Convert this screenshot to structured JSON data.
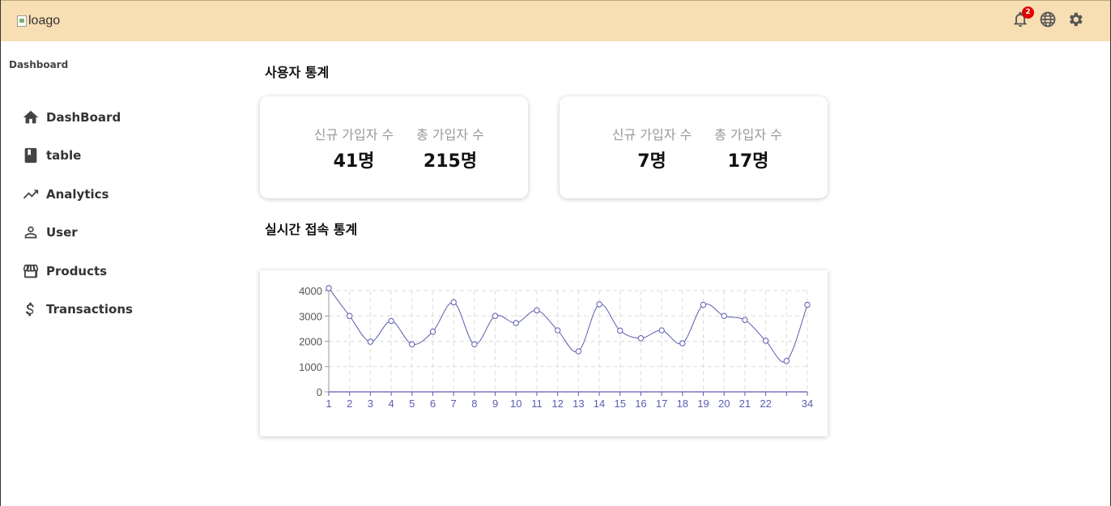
{
  "header": {
    "logo_alt": "loago",
    "notification_count": "2",
    "icons": [
      "bell-icon",
      "globe-icon",
      "gear-icon"
    ],
    "background": "#f7deb3"
  },
  "sidebar": {
    "title": "Dashboard",
    "items": [
      {
        "label": "DashBoard",
        "icon": "home-icon"
      },
      {
        "label": "table",
        "icon": "book-icon"
      },
      {
        "label": "Analytics",
        "icon": "trending-up-icon"
      },
      {
        "label": "User",
        "icon": "user-icon"
      },
      {
        "label": "Products",
        "icon": "store-icon"
      },
      {
        "label": "Transactions",
        "icon": "dollar-icon"
      }
    ]
  },
  "main": {
    "user_stats_title": "사용자 통계",
    "cards": [
      {
        "new_label": "신규 가입자 수",
        "new_value": "41명",
        "total_label": "총 가입자 수",
        "total_value": "215명"
      },
      {
        "new_label": "신규 가입자 수",
        "new_value": "7명",
        "total_label": "총 가입자 수",
        "total_value": "17명"
      }
    ],
    "realtime_title": "실시간 접속 통계"
  },
  "chart_data": {
    "type": "line",
    "x": [
      "1",
      "2",
      "3",
      "4",
      "5",
      "6",
      "7",
      "8",
      "9",
      "10",
      "11",
      "12",
      "13",
      "14",
      "15",
      "16",
      "17",
      "18",
      "19",
      "20",
      "21",
      "22",
      "23",
      "34"
    ],
    "tick_labels": [
      "1",
      "2",
      "3",
      "4",
      "5",
      "6",
      "7",
      "8",
      "9",
      "10",
      "11",
      "12",
      "13",
      "14",
      "15",
      "16",
      "17",
      "18",
      "19",
      "20",
      "21",
      "22",
      "",
      "34"
    ],
    "series": [
      {
        "values": [
          4100,
          3000,
          1980,
          2800,
          1880,
          2380,
          3540,
          1880,
          3000,
          2720,
          3220,
          2430,
          1600,
          3460,
          2420,
          2120,
          2430,
          1920,
          3440,
          3000,
          2840,
          2020,
          1220,
          3440
        ],
        "color": "#5c5cb3"
      }
    ],
    "yticks": [
      0,
      1000,
      2000,
      3000,
      4000
    ],
    "ylim": [
      0,
      4000
    ],
    "grid": true,
    "tick_color": "#5c5cb3"
  }
}
